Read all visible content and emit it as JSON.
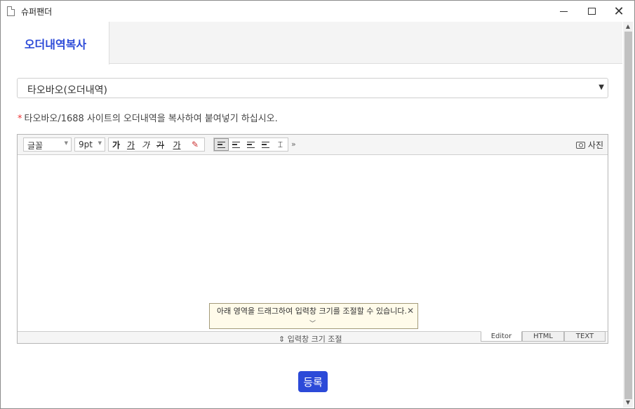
{
  "window": {
    "title": "슈퍼팬더"
  },
  "tabs": [
    {
      "label": "오더내역복사"
    }
  ],
  "source_select": {
    "value": "타오바오(오더내역)"
  },
  "notice": {
    "star": "*",
    "text": "타오바오/1688 사이트의 오더내역을 복사하여 붙여넣기 하십시오."
  },
  "toolbar": {
    "font_family": "글꼴",
    "font_size": "9pt",
    "bold": "가",
    "underline": "가",
    "italic": "가",
    "strike": "가",
    "font_color": "가",
    "more": "»",
    "photo": "사진"
  },
  "editor": {
    "tooltip": "아래 영역을 드래그하여 입력창 크기를 조절할 수 있습니다.",
    "resize_label": "⇕ 입력창 크기 조절",
    "modes": [
      "Editor",
      "HTML",
      "TEXT"
    ]
  },
  "submit_label": "등록"
}
